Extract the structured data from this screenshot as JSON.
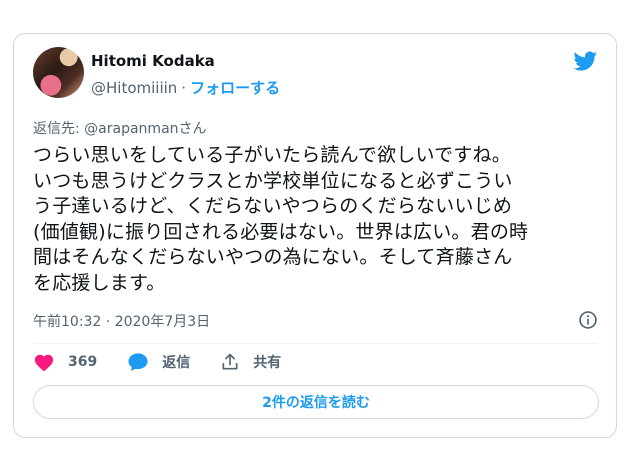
{
  "author": {
    "name": "Hitomi Kodaka",
    "handle": "@Hitomiiiin",
    "separator": "·",
    "follow_label": "フォローする"
  },
  "reply": {
    "prefix": "返信先: ",
    "target": "@arapanmanさん"
  },
  "tweet": {
    "text": "つらい思いをしている子がいたら読んで欲しいですね。\nいつも思うけどクラスとか学校単位になると必ずこうい\nう子達いるけど、くだらないやつらのくだらないいじめ\n(価値観)に振り回される必要はない。世界は広い。君の時\n間はそんなくだらないやつの為にない。そして斉藤さん\nを応援します。",
    "timestamp": "午前10:32 · 2020年7月3日"
  },
  "actions": {
    "likes_count": "369",
    "reply_label": "返信",
    "share_label": "共有"
  },
  "footer": {
    "more_replies_label": "2件の返信を読む"
  },
  "colors": {
    "brand": "#1d9bf0",
    "like": "#f91880",
    "text": "#0f1419",
    "muted": "#536471"
  },
  "icons": [
    "twitter-bird-icon",
    "info-icon",
    "heart-icon",
    "speech-bubble-icon",
    "share-icon"
  ]
}
